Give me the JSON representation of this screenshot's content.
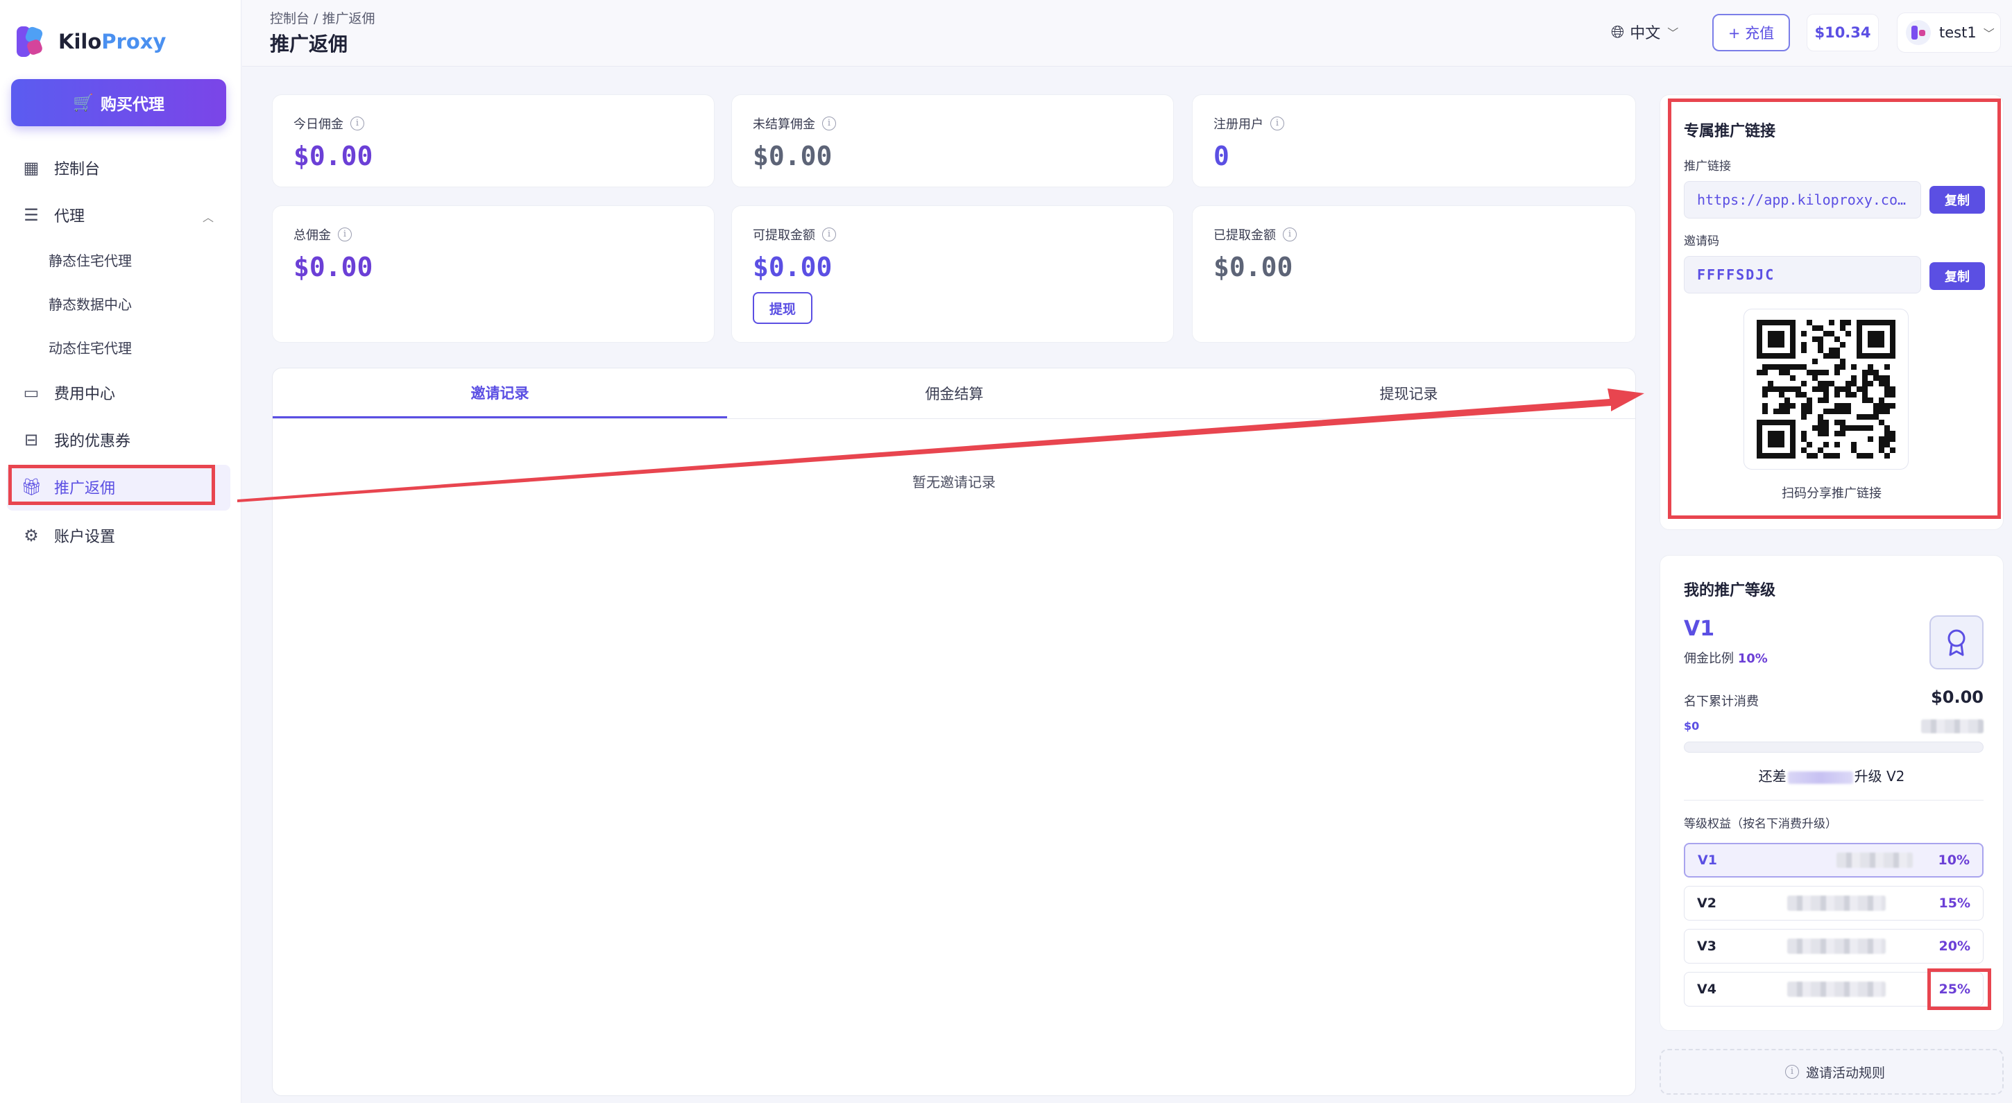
{
  "brand": {
    "name_a": "Kilo",
    "name_b": "Proxy"
  },
  "sidebar": {
    "buy_label": "购买代理",
    "items": [
      {
        "label": "控制台",
        "icon": "dashboard-icon"
      },
      {
        "label": "代理",
        "icon": "server-icon"
      },
      {
        "label": "静态住宅代理"
      },
      {
        "label": "静态数据中心"
      },
      {
        "label": "动态住宅代理"
      },
      {
        "label": "费用中心",
        "icon": "wallet-icon"
      },
      {
        "label": "我的优惠券",
        "icon": "ticket-icon"
      },
      {
        "label": "推广返佣",
        "icon": "gift-icon",
        "active": true
      },
      {
        "label": "账户设置",
        "icon": "gear-icon"
      }
    ]
  },
  "header": {
    "breadcrumb": "控制台 / 推广返佣",
    "title": "推广返佣",
    "language": "中文",
    "recharge_label": "+ 充值",
    "balance": "$10.34",
    "username": "test1"
  },
  "stats": [
    {
      "label": "今日佣金",
      "value": "$0.00"
    },
    {
      "label": "未结算佣金",
      "value": "$0.00"
    },
    {
      "label": "注册用户",
      "value": "0"
    },
    {
      "label": "总佣金",
      "value": "$0.00"
    },
    {
      "label": "可提取金额",
      "value": "$0.00",
      "button": "提现"
    },
    {
      "label": "已提取金额",
      "value": "$0.00"
    }
  ],
  "tabs": {
    "items": [
      "邀请记录",
      "佣金结算",
      "提现记录"
    ],
    "active_index": 0,
    "empty_text": "暂无邀请记录"
  },
  "referral": {
    "title": "专属推广链接",
    "link_label": "推广链接",
    "link_value": "https://app.kiloproxy.co…",
    "code_label": "邀请码",
    "code_value": "FFFFSDJC",
    "copy_label": "复制",
    "qr_caption": "扫码分享推广链接"
  },
  "level": {
    "title": "我的推广等级",
    "current": "V1",
    "rate_prefix": "佣金比例 ",
    "rate": "10%",
    "consume_label": "名下累计消费",
    "consume_value": "$0.00",
    "progress_start": "$0",
    "progress_fraction": 0,
    "upgrade_prefix": "还差",
    "upgrade_suffix": "升级 V2",
    "rights_label": "等级权益（按名下消费升级）",
    "tiers": [
      {
        "name": "V1",
        "pct": "10%"
      },
      {
        "name": "V2",
        "pct": "15%"
      },
      {
        "name": "V3",
        "pct": "20%"
      },
      {
        "name": "V4",
        "pct": "25%"
      }
    ]
  },
  "rules_label": "邀请活动规则",
  "colors": {
    "accent": "#5b4fe3",
    "highlight": "#e8454f",
    "value_purple": "#6b3fd6"
  }
}
